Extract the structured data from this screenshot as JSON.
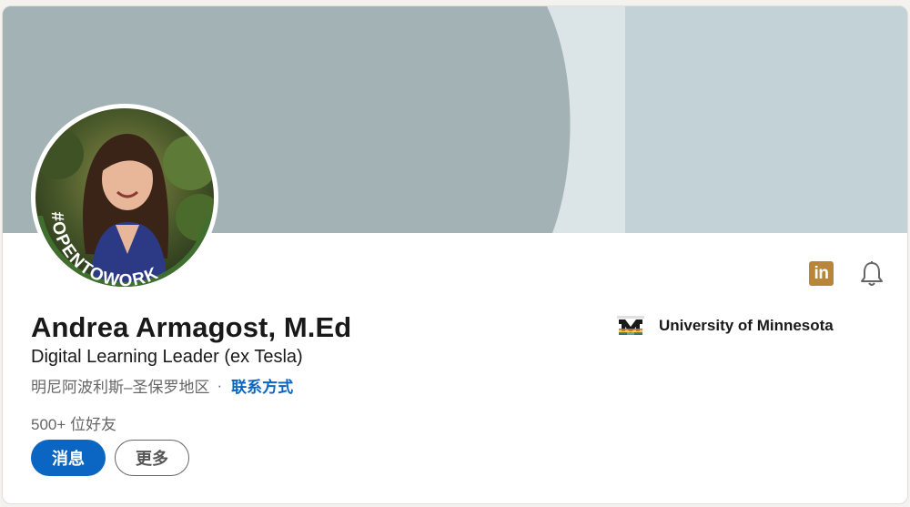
{
  "profile": {
    "name": "Andrea Armagost, M.Ed",
    "headline": "Digital Learning Leader (ex Tesla)",
    "location": "明尼阿波利斯–圣保罗地区",
    "separator": "·",
    "contact_label": "联系方式",
    "connections": "500+ 位好友",
    "open_to_work_badge": "#OPENTOWORK"
  },
  "actions": {
    "message_label": "消息",
    "more_label": "更多"
  },
  "education": {
    "name": "University of Minnesota"
  },
  "icons": {
    "linkedin": "linkedin-icon",
    "bell": "bell-icon",
    "university_logo": "university-of-minnesota-logo"
  },
  "colors": {
    "accent": "#0a66c2",
    "open_to_work_green": "#3f6e2e",
    "banner_light": "#c2d2d6",
    "banner_dark": "#a2b2b5",
    "linkedin_icon_bg": "#b8863b"
  }
}
